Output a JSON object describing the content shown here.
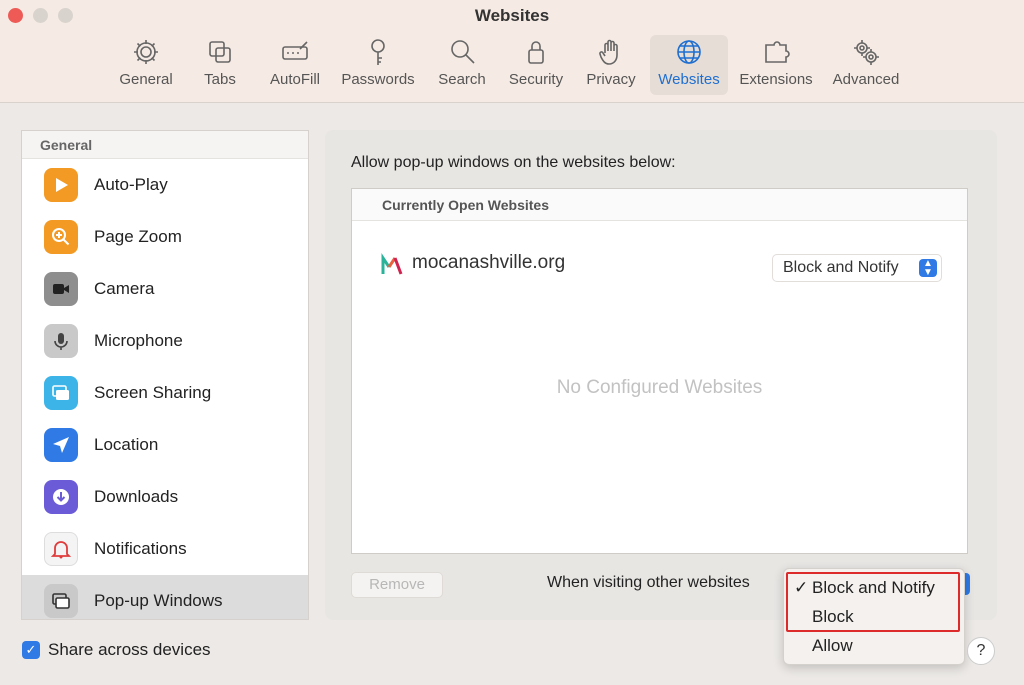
{
  "window": {
    "title": "Websites"
  },
  "toolbar": {
    "tabs": [
      {
        "label": "General",
        "icon": "gear-icon"
      },
      {
        "label": "Tabs",
        "icon": "tabs-icon"
      },
      {
        "label": "AutoFill",
        "icon": "autofill-icon"
      },
      {
        "label": "Passwords",
        "icon": "key-icon"
      },
      {
        "label": "Search",
        "icon": "search-icon"
      },
      {
        "label": "Security",
        "icon": "lock-icon"
      },
      {
        "label": "Privacy",
        "icon": "hand-icon"
      },
      {
        "label": "Websites",
        "icon": "globe-icon",
        "active": true
      },
      {
        "label": "Extensions",
        "icon": "puzzle-icon"
      },
      {
        "label": "Advanced",
        "icon": "gears-icon"
      }
    ],
    "active_color": "#1f6fd1"
  },
  "sidebar": {
    "header": "General",
    "items": [
      {
        "label": "Auto-Play",
        "icon": "play-icon",
        "color": "#f39a24"
      },
      {
        "label": "Page Zoom",
        "icon": "zoom-icon",
        "color": "#f39a24"
      },
      {
        "label": "Camera",
        "icon": "camera-icon",
        "color": "#8e8e8e"
      },
      {
        "label": "Microphone",
        "icon": "microphone-icon",
        "color": "#b0b0b0"
      },
      {
        "label": "Screen Sharing",
        "icon": "screen-sharing-icon",
        "color": "#3cb4e8"
      },
      {
        "label": "Location",
        "icon": "location-icon",
        "color": "#2f7ae5"
      },
      {
        "label": "Downloads",
        "icon": "download-icon",
        "color": "#6b5bd6"
      },
      {
        "label": "Notifications",
        "icon": "bell-icon",
        "color": "#e03c3c"
      },
      {
        "label": "Pop-up Windows",
        "icon": "popup-windows-icon",
        "color": "#8e8e8e",
        "selected": true
      }
    ]
  },
  "main": {
    "allow_label": "Allow pop-up windows on the websites below:",
    "table_header": "Currently Open Websites",
    "site": {
      "name": "mocanashville.org",
      "setting": "Block and Notify"
    },
    "empty_text": "No Configured Websites",
    "remove_label": "Remove",
    "visiting_label": "When visiting other websites"
  },
  "popup_menu": {
    "items": [
      {
        "label": "Block and Notify",
        "checked": true
      },
      {
        "label": "Block",
        "checked": false
      },
      {
        "label": "Allow",
        "checked": false
      }
    ],
    "check_glyph": "✓",
    "highlight_color": "#dd2b2b"
  },
  "footer": {
    "share_label": "Share across devices",
    "share_checked": true,
    "checkbox_glyph": "✓",
    "help_label": "?"
  }
}
